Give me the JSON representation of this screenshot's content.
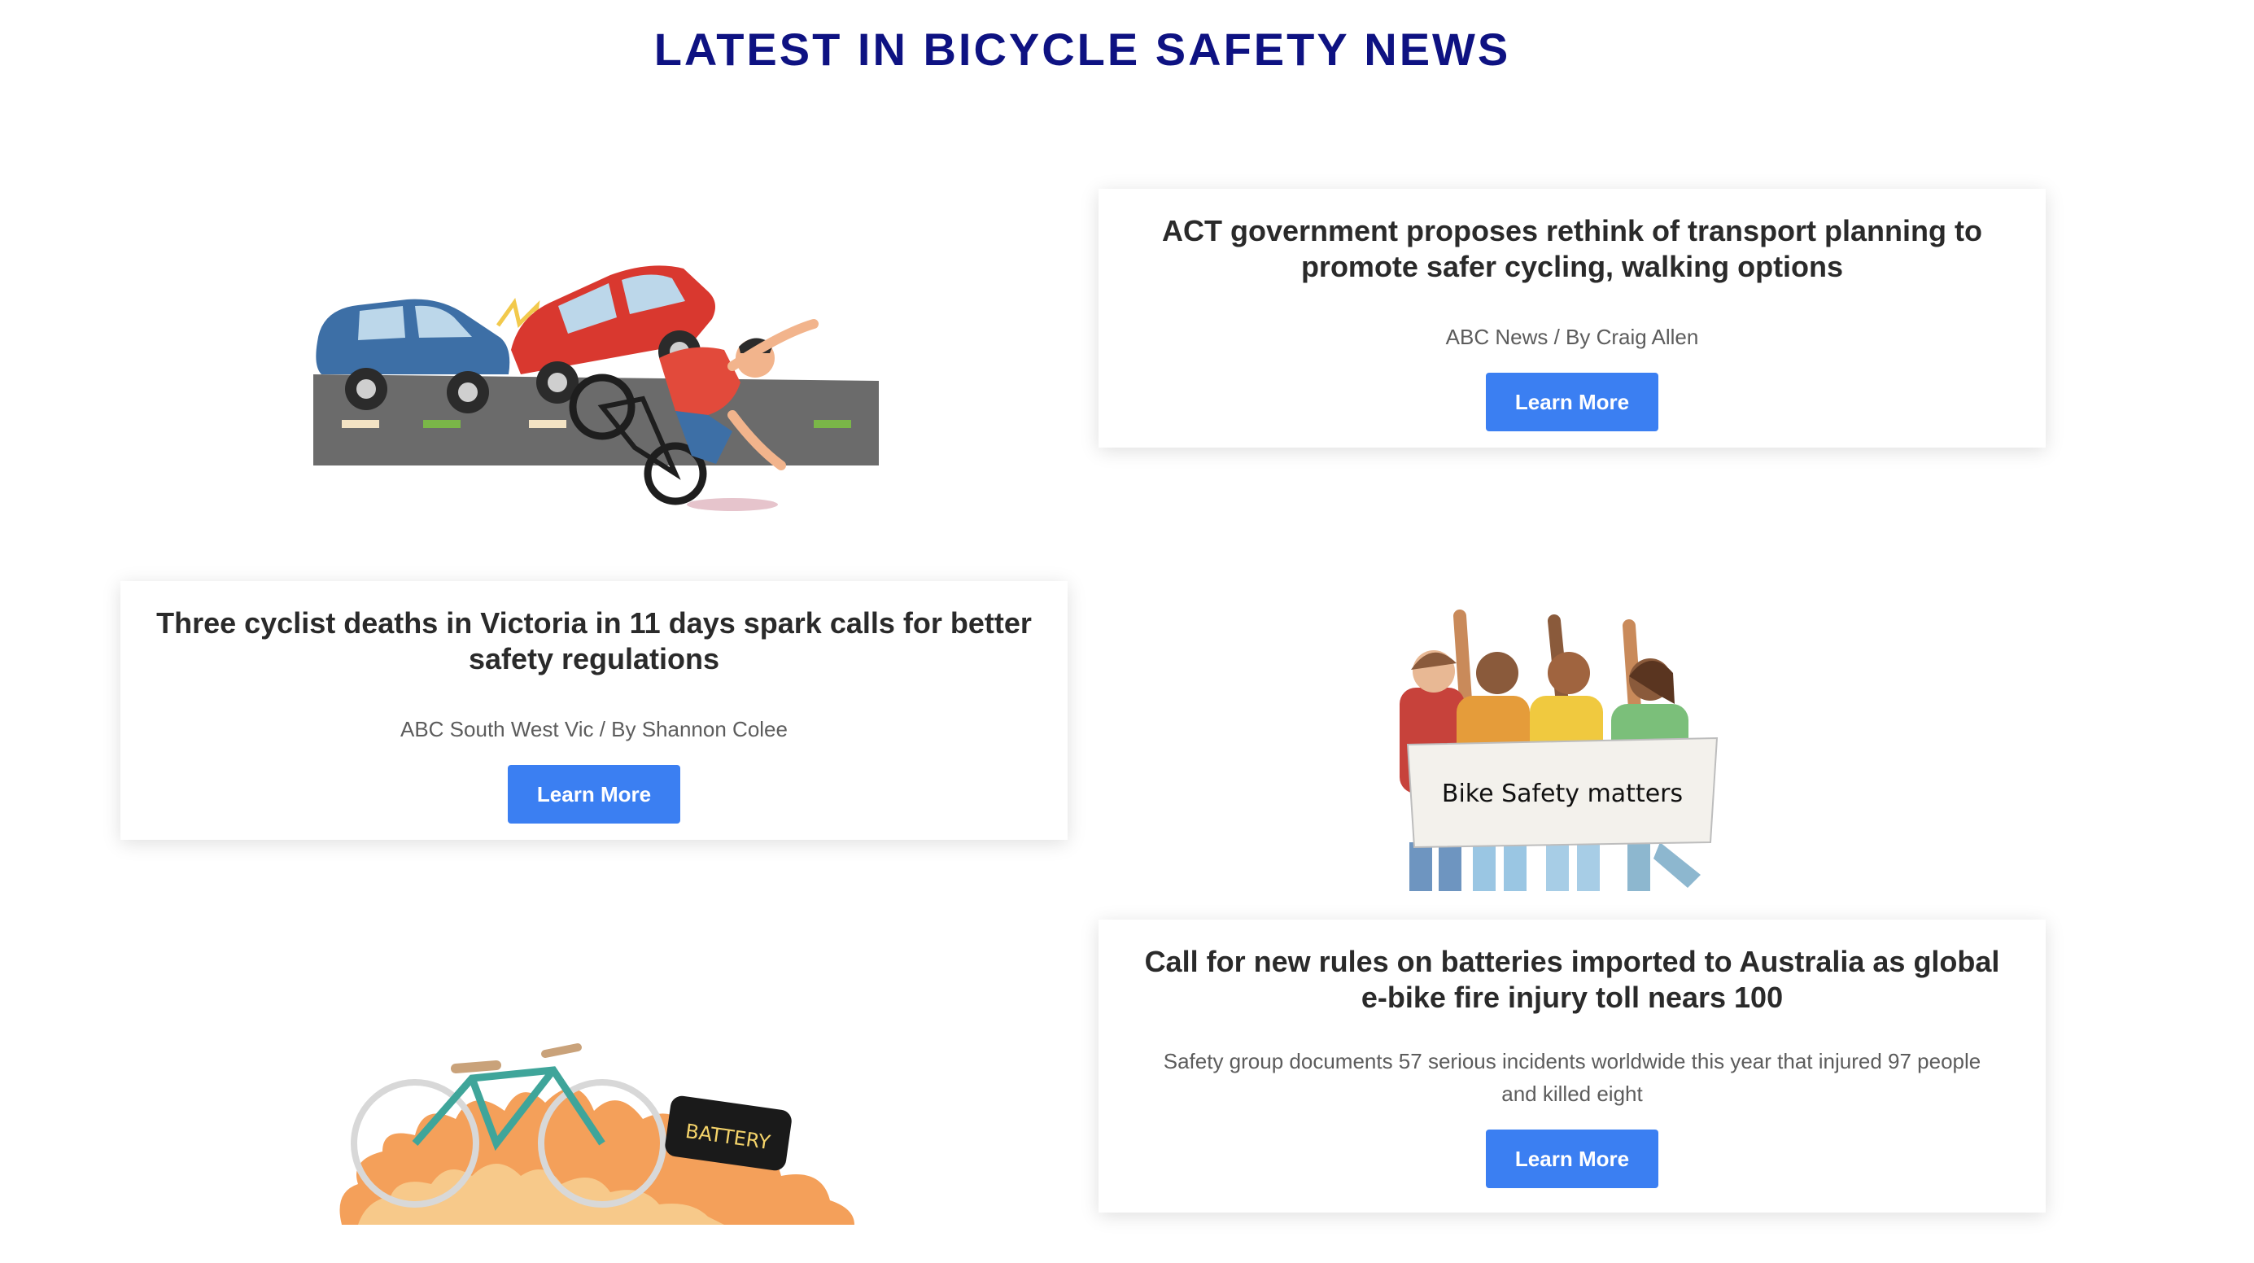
{
  "page": {
    "title": "LATEST IN BICYCLE SAFETY NEWS"
  },
  "articles": [
    {
      "headline": "ACT government proposes rethink of transport planning to promote safer cycling, walking options",
      "byline": "ABC News / By Craig Allen",
      "button_label": "Learn More"
    },
    {
      "headline": "Three cyclist deaths in Victoria in 11 days spark calls for better safety regulations",
      "byline": "ABC South West Vic / By Shannon Colee",
      "button_label": "Learn More"
    },
    {
      "headline": "Call for new rules on batteries imported to Australia as global e-bike fire injury toll nears 100",
      "byline": "Safety group documents 57 serious incidents worldwide this year that injured 97 people and killed eight",
      "button_label": "Learn More"
    }
  ],
  "illustrations": {
    "protest_sign_text": "Bike Safety matters",
    "battery_label": "BATTERY"
  },
  "colors": {
    "title": "#0e1282",
    "button": "#3b7ff2",
    "headline": "#2a2a2a",
    "byline": "#5c5c5c"
  }
}
